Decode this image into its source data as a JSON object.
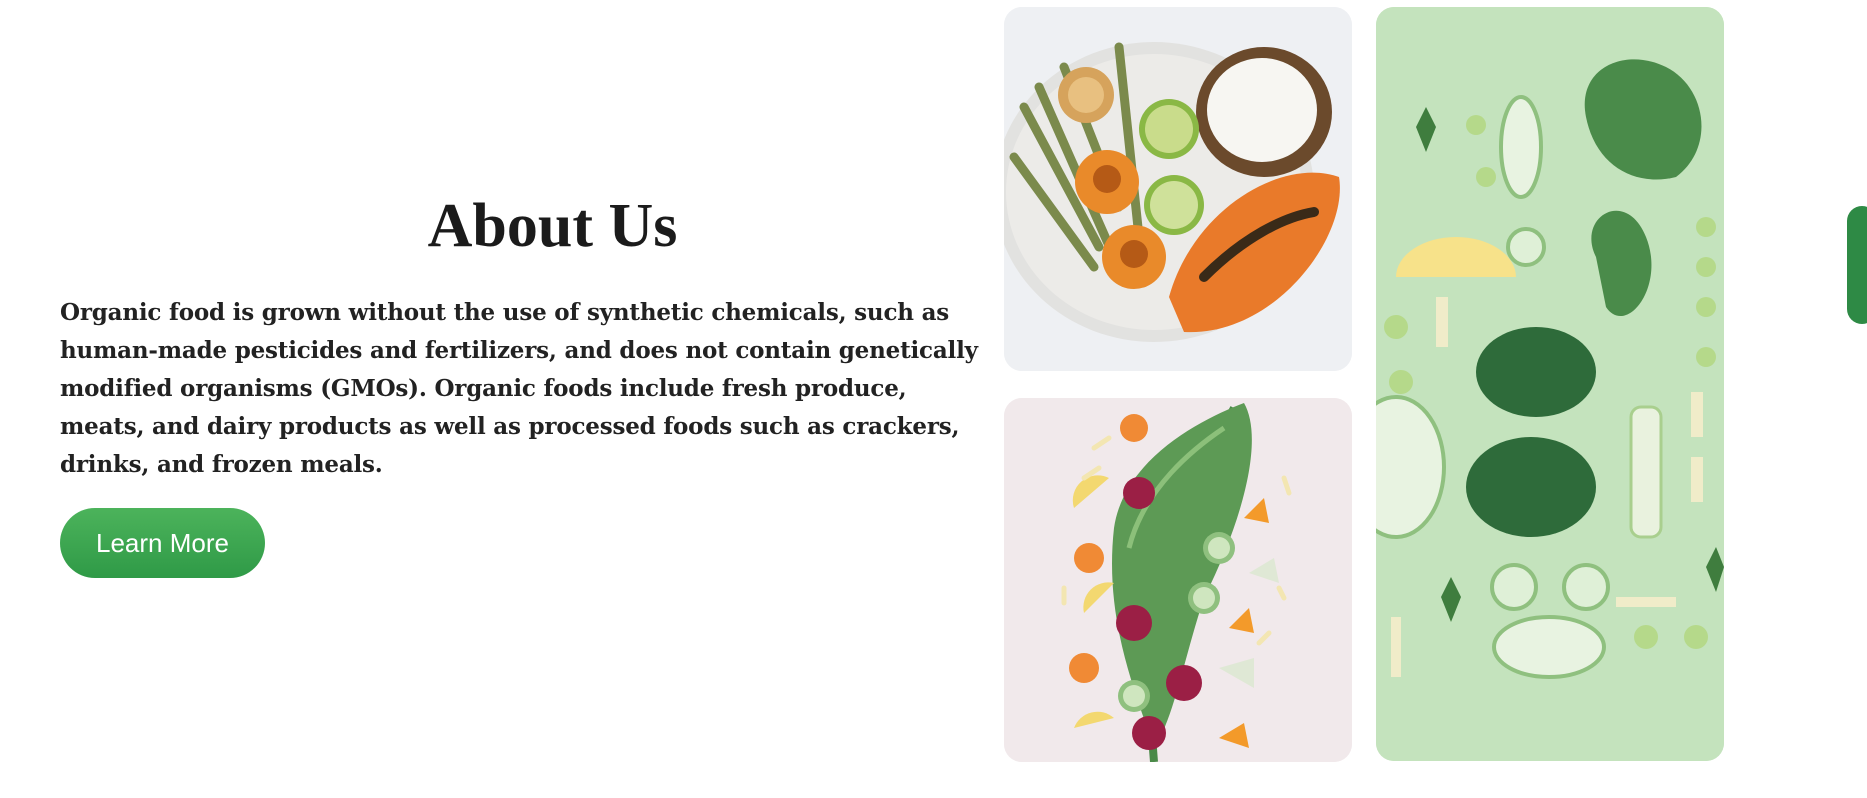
{
  "about": {
    "title": "About Us",
    "description": "Organic food is grown without the use of synthetic chemicals, such as human-made pesticides and fertilizers, and does not contain genetically modified organisms (GMOs). Organic foods include fresh produce, meats, and dairy products as well as processed foods such as crackers, drinks, and frozen meals.",
    "button_label": "Learn More"
  },
  "gallery": {
    "images": [
      {
        "name": "fruit-plate-photo",
        "subject": "plate with coconut, limes, apricots and papaya"
      },
      {
        "name": "vegetable-flatlay-photo",
        "subject": "kale, beets, carrots, cucumbers and citrus slices"
      },
      {
        "name": "green-vegetables-photo",
        "subject": "green vegetables on green background"
      }
    ]
  },
  "colors": {
    "accent": "#3aa553",
    "side_tab": "#2e8a45",
    "text": "#222222"
  }
}
